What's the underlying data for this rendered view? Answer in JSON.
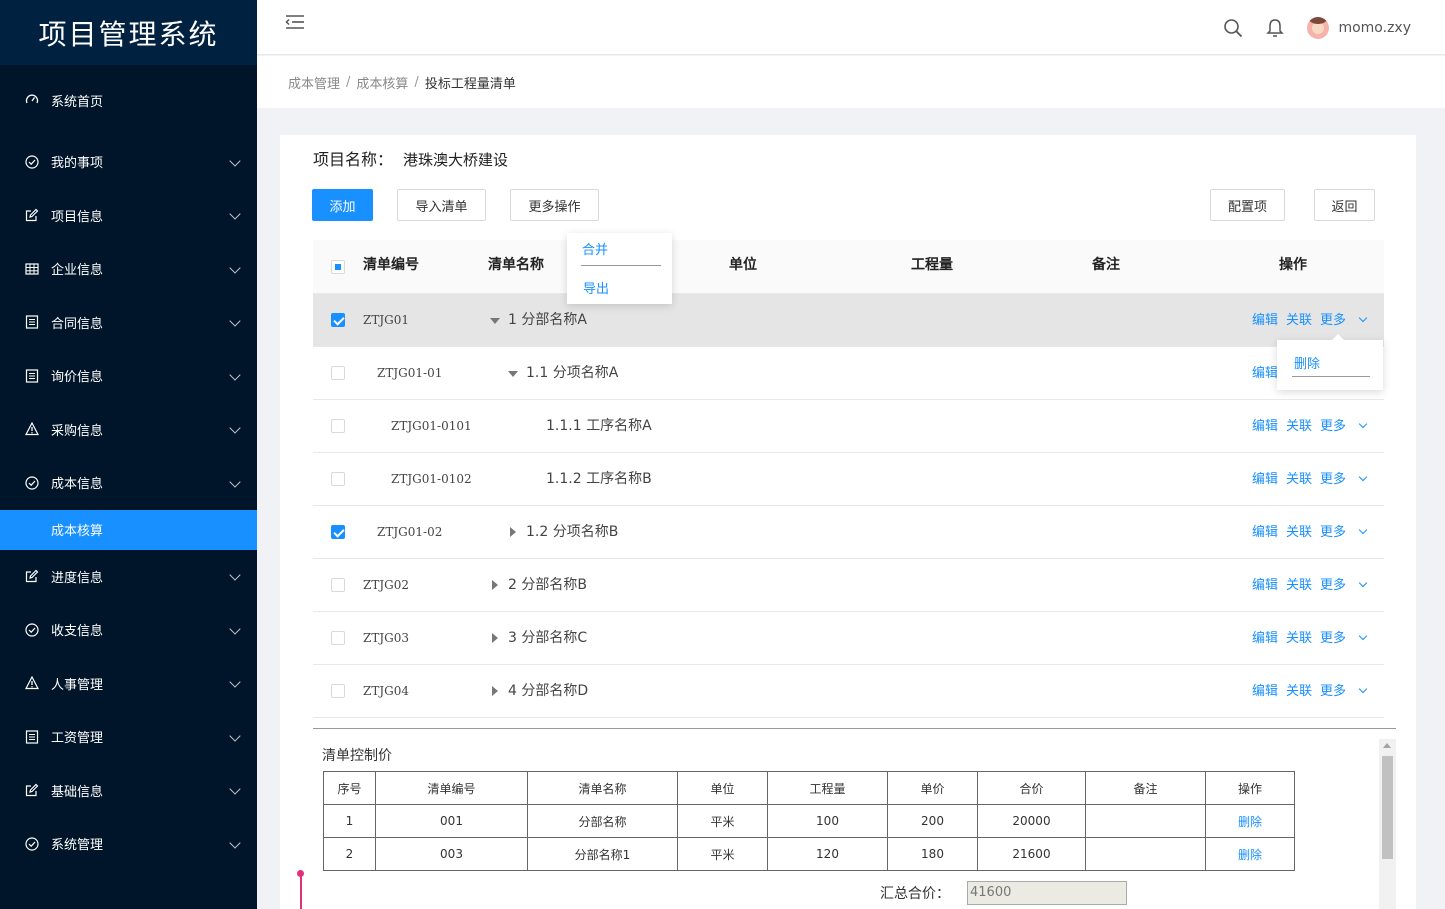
{
  "app": {
    "title": "项目管理系统"
  },
  "sidebar": {
    "items": [
      {
        "label": "系统首页",
        "icon": "dashboard-icon",
        "expandable": false
      },
      {
        "label": "我的事项",
        "icon": "check-circle-icon",
        "expandable": true
      },
      {
        "label": "项目信息",
        "icon": "edit-icon",
        "expandable": true
      },
      {
        "label": "企业信息",
        "icon": "table-icon",
        "expandable": true
      },
      {
        "label": "合同信息",
        "icon": "file-icon",
        "expandable": true
      },
      {
        "label": "询价信息",
        "icon": "file-icon",
        "expandable": true
      },
      {
        "label": "采购信息",
        "icon": "warning-icon",
        "expandable": true
      },
      {
        "label": "成本信息",
        "icon": "check-circle-icon",
        "expandable": true
      },
      {
        "label": "进度信息",
        "icon": "edit-icon",
        "expandable": true
      },
      {
        "label": "收支信息",
        "icon": "check-circle-icon",
        "expandable": true
      },
      {
        "label": "人事管理",
        "icon": "warning-icon",
        "expandable": true
      },
      {
        "label": "工资管理",
        "icon": "file-icon",
        "expandable": true
      },
      {
        "label": "基础信息",
        "icon": "edit-icon",
        "expandable": true
      },
      {
        "label": "系统管理",
        "icon": "check-circle-icon",
        "expandable": true
      }
    ],
    "active_sub": "成本核算"
  },
  "header": {
    "username": "momo.zxy"
  },
  "breadcrumb": [
    "成本管理",
    "成本核算",
    "投标工程量清单"
  ],
  "project": {
    "label": "项目名称：",
    "name": "港珠澳大桥建设"
  },
  "toolbar": {
    "add": "添加",
    "import": "导入清单",
    "more": "更多操作",
    "config": "配置项",
    "back": "返回"
  },
  "more_menu": [
    "合并",
    "导出"
  ],
  "row_menu": [
    "删除"
  ],
  "table": {
    "headers": [
      "清单编号",
      "清单名称",
      "单位",
      "工程量",
      "备注",
      "操作"
    ],
    "rows": [
      {
        "code": "ZTJG01",
        "name": "1 分部名称A",
        "checked": true,
        "expand": "down"
      },
      {
        "code": "ZTJG01-01",
        "name": "1.1 分项名称A",
        "checked": false,
        "expand": "down"
      },
      {
        "code": "ZTJG01-0101",
        "name": "1.1.1 工序名称A",
        "checked": false,
        "expand": "none"
      },
      {
        "code": "ZTJG01-0102",
        "name": "1.1.2 工序名称B",
        "checked": false,
        "expand": "none"
      },
      {
        "code": "ZTJG01-02",
        "name": "1.2 分项名称B",
        "checked": true,
        "expand": "right"
      },
      {
        "code": "ZTJG02",
        "name": "2 分部名称B",
        "checked": false,
        "expand": "right"
      },
      {
        "code": "ZTJG03",
        "name": "3 分部名称C",
        "checked": false,
        "expand": "right"
      },
      {
        "code": "ZTJG04",
        "name": "4 分部名称D",
        "checked": false,
        "expand": "right"
      }
    ],
    "ops": {
      "edit": "编辑",
      "link": "关联",
      "more": "更多"
    }
  },
  "control": {
    "title": "清单控制价",
    "headers": [
      "序号",
      "清单编号",
      "清单名称",
      "单位",
      "工程量",
      "单价",
      "合价",
      "备注",
      "操作"
    ],
    "rows": [
      [
        "1",
        "001",
        "分部名称",
        "平米",
        "100",
        "200",
        "20000",
        "",
        "删除"
      ],
      [
        "2",
        "003",
        "分部名称1",
        "平米",
        "120",
        "180",
        "21600",
        "",
        "删除"
      ]
    ],
    "total_label": "汇总合价：",
    "total_value": "41600"
  }
}
